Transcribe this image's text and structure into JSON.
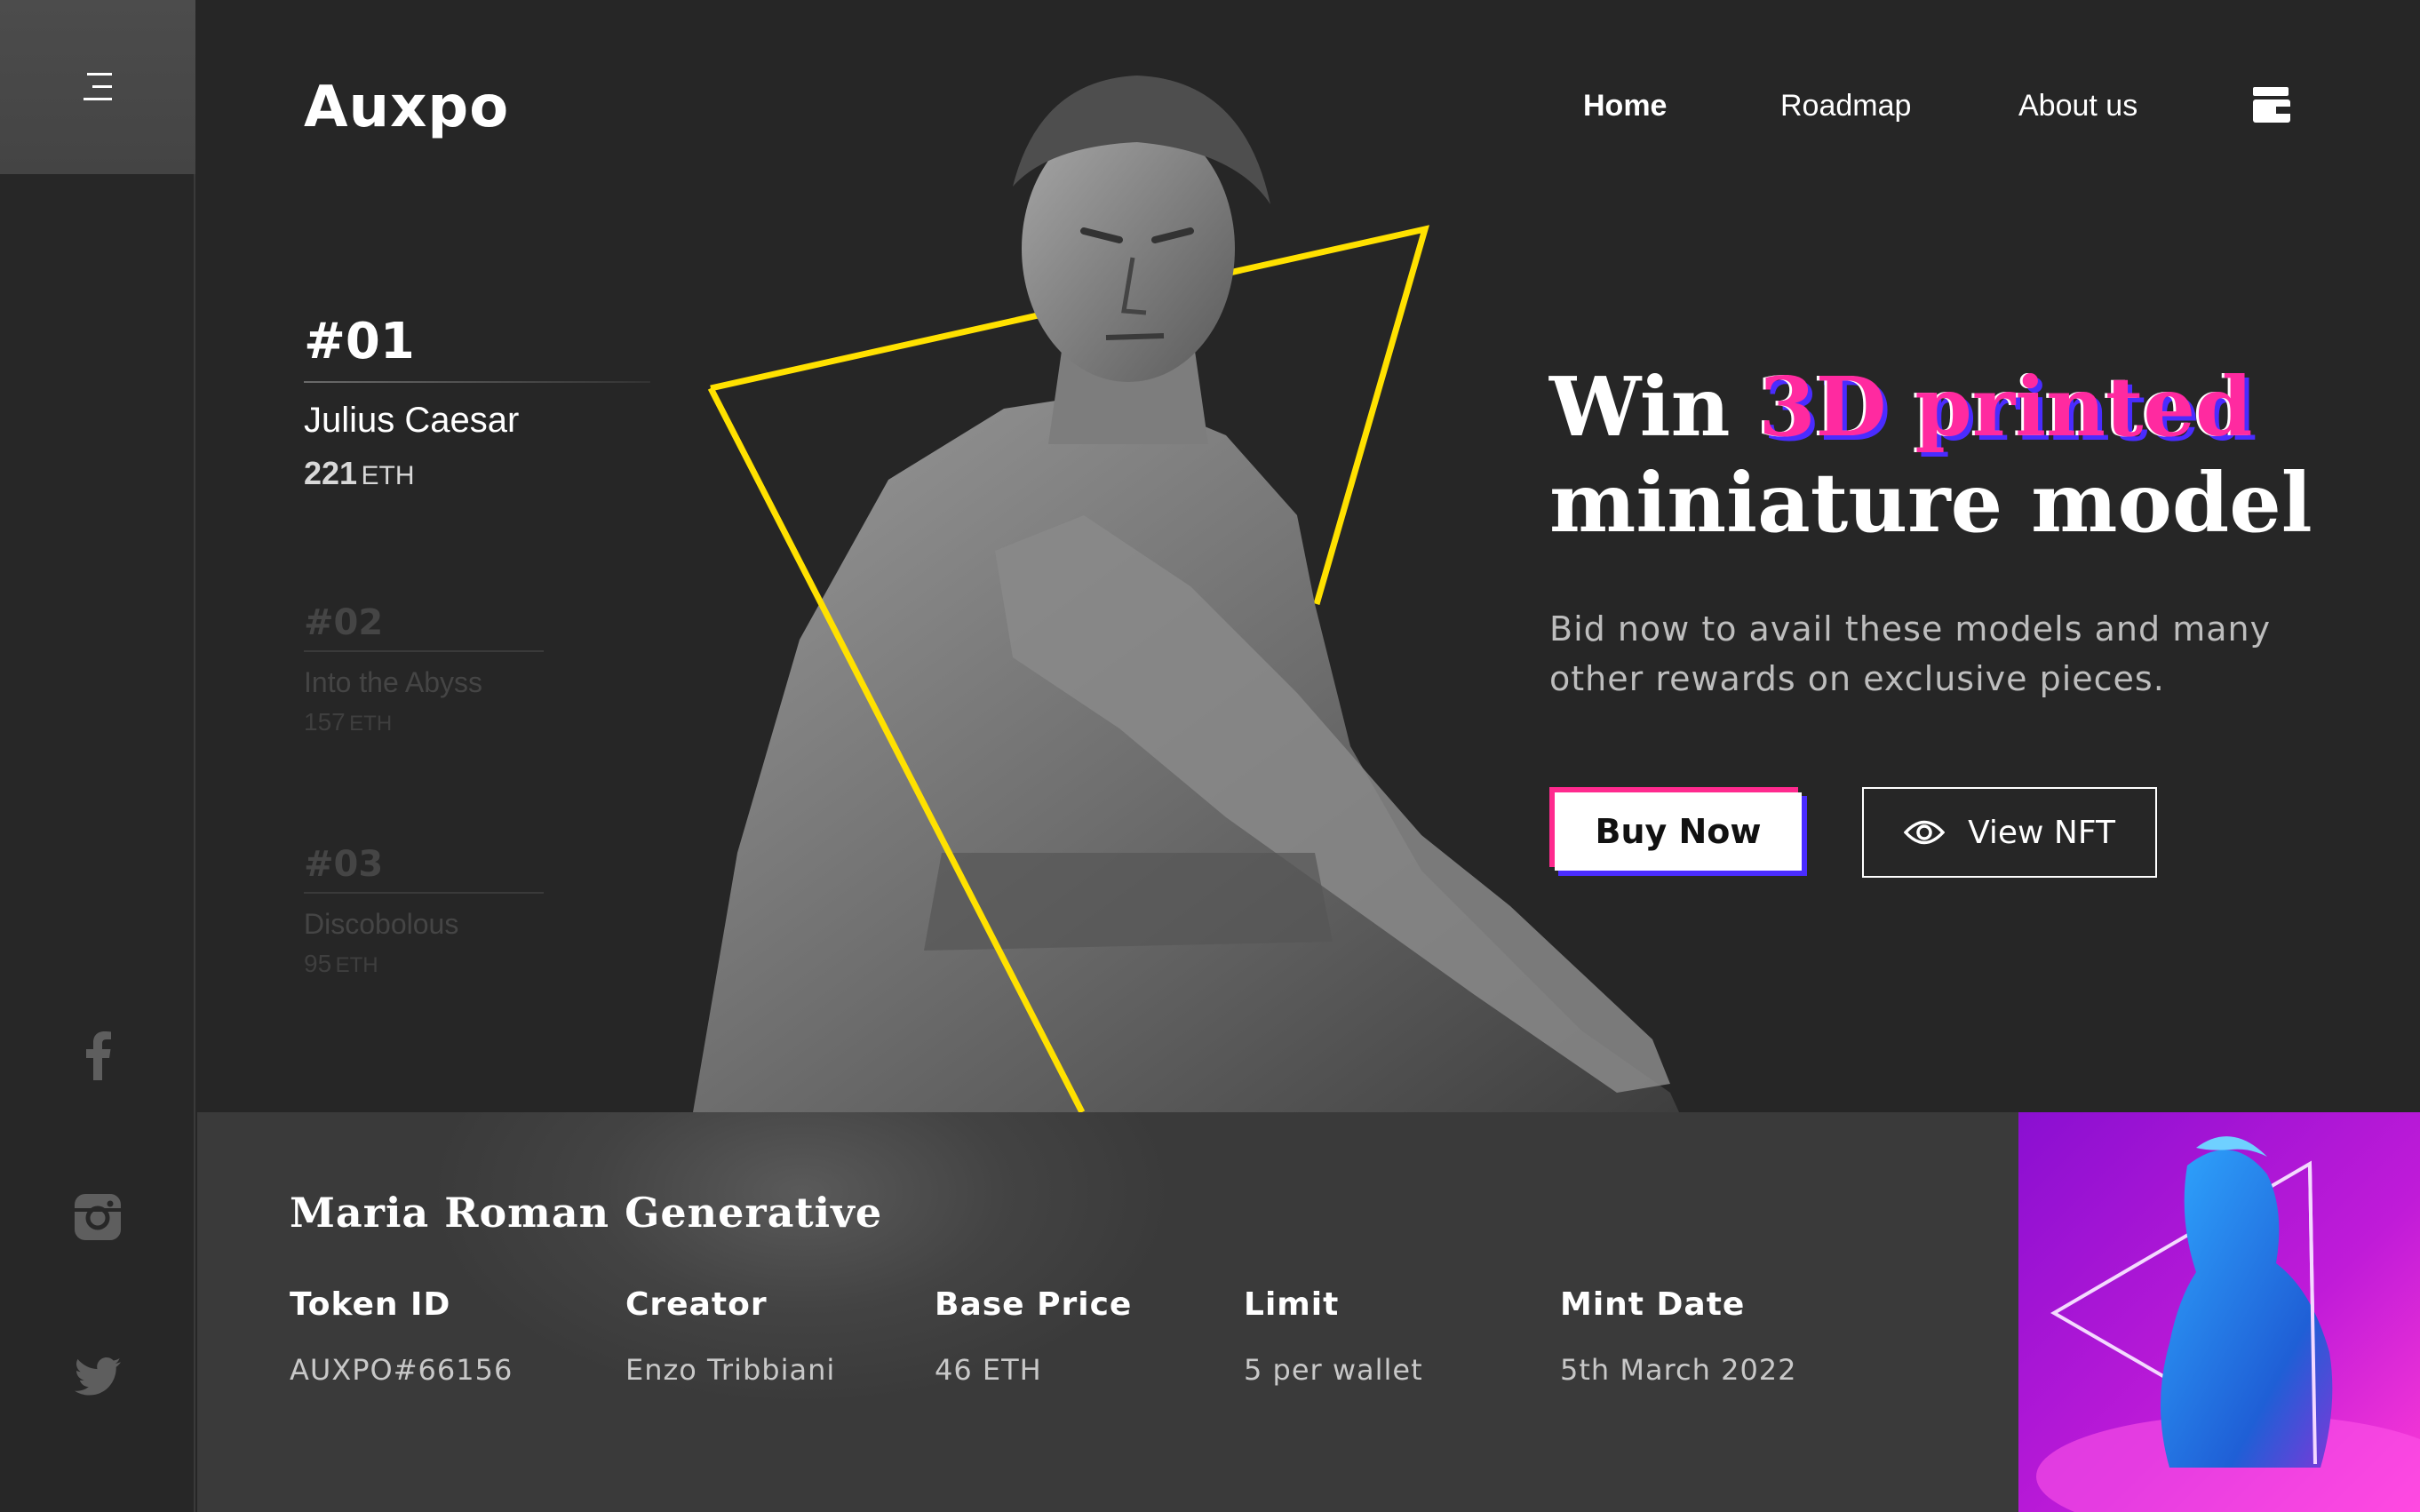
{
  "brand": {
    "name": "Auxpo"
  },
  "nav": {
    "items": [
      {
        "label": "Home",
        "active": true
      },
      {
        "label": "Roadmap",
        "active": false
      },
      {
        "label": "About us",
        "active": false
      }
    ],
    "wallet_icon": "wallet-icon"
  },
  "sidebar": {
    "menu_icon": "menu-icon",
    "social": [
      "facebook-icon",
      "instagram-icon",
      "twitter-icon"
    ]
  },
  "collection": [
    {
      "number": "#01",
      "name": "Julius Caesar",
      "price": "221",
      "unit": "ETH",
      "active": true
    },
    {
      "number": "#02",
      "name": "Into the Abyss",
      "price": "157",
      "unit": "ETH",
      "active": false
    },
    {
      "number": "#03",
      "name": "Discobolous",
      "price": "95",
      "unit": "ETH",
      "active": false
    }
  ],
  "hero": {
    "headline_prefix": "Win ",
    "headline_accent": "3D printed",
    "headline_line2": "miniature model",
    "subtext": "Bid now to avail these models and many other rewards on exclusive pieces.",
    "buy_label": "Buy Now",
    "view_label": "View NFT"
  },
  "details": {
    "title": "Maria Roman Generative",
    "columns": [
      {
        "label": "Token ID",
        "value": "AUXPO#66156"
      },
      {
        "label": "Creator",
        "value": "Enzo Tribbiani"
      },
      {
        "label": "Base Price",
        "value": "46 ETH"
      },
      {
        "label": "Limit",
        "value": "5 per wallet"
      },
      {
        "label": "Mint Date",
        "value": "5th March 2022"
      }
    ]
  },
  "colors": {
    "background": "#262626",
    "accent_pink": "#ff2aa0",
    "accent_blue": "#4a2cff",
    "triangle_yellow": "#ffe100"
  }
}
